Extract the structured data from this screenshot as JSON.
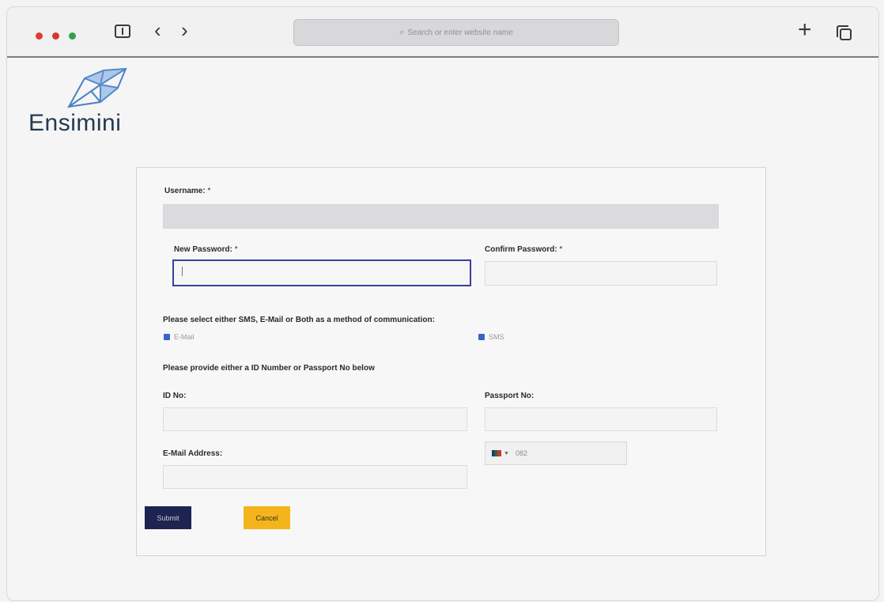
{
  "browser": {
    "address_placeholder": "Search or enter website name"
  },
  "brand": {
    "name": "Ensimini"
  },
  "form": {
    "username_label": "Username:",
    "username_required": "*",
    "new_password_label": "New Password:",
    "new_password_required": "*",
    "confirm_password_label": "Confirm Password:",
    "confirm_password_required": "*",
    "communication_prompt": "Please select either SMS, E-Mail or Both as a method of communication:",
    "email_option": "E-Mail",
    "email_checked": true,
    "sms_option": "SMS",
    "sms_checked": true,
    "id_prompt": "Please provide either a ID Number or Passport No below",
    "id_label": "ID No:",
    "passport_label": "Passport No:",
    "email_label": "E-Mail Address:",
    "phone_prefix": "082",
    "submit_label": "Submit",
    "cancel_label": "Cancel"
  },
  "colors": {
    "submit_bg": "#1e2450",
    "cancel_bg": "#f4b41c",
    "focus_border": "#3b3f9a",
    "checkbox": "#3a63c8",
    "logo": "#24394f"
  }
}
